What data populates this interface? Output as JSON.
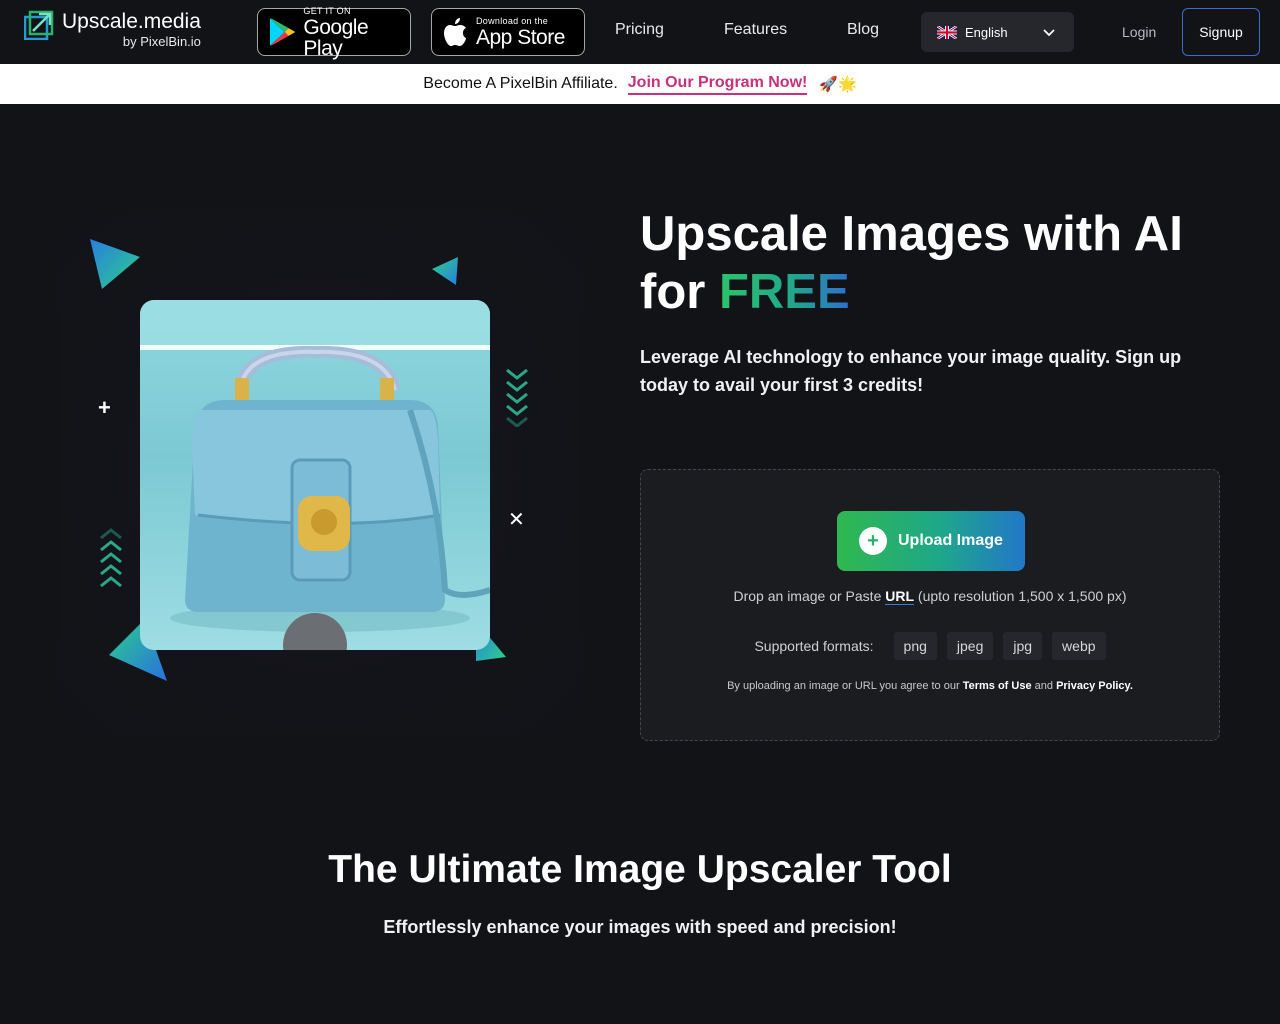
{
  "header": {
    "logo_title": "Upscale.media",
    "logo_sub": "by PixelBin.io",
    "google_play": {
      "small": "GET IT ON",
      "big": "Google Play"
    },
    "app_store": {
      "small": "Download on the",
      "big": "App Store"
    },
    "nav": {
      "pricing": "Pricing",
      "features": "Features",
      "blog": "Blog"
    },
    "language": "English",
    "login": "Login",
    "signup": "Signup"
  },
  "banner": {
    "text": "Become A PixelBin Affiliate.",
    "link": "Join Our Program Now!",
    "emoji": "🚀🌟"
  },
  "hero": {
    "title_line1": "Upscale Images with AI",
    "title_for": "for",
    "title_free": "FREE",
    "subtitle": "Leverage AI technology to enhance your image quality. Sign up today to avail your first 3 credits!"
  },
  "upload": {
    "button_label": "Upload Image",
    "drop_prefix": "Drop an image or Paste",
    "drop_url": "URL",
    "drop_suffix": "(upto resolution 1,500 x 1,500 px)",
    "formats_label": "Supported formats:",
    "formats": [
      "png",
      "jpeg",
      "jpg",
      "webp"
    ],
    "terms_prefix": "By uploading an image or URL you agree to our",
    "terms_link": "Terms of Use",
    "terms_and": "and",
    "privacy_link": "Privacy Policy."
  },
  "section": {
    "title": "The Ultimate Image Upscaler Tool",
    "subtitle": "Effortlessly enhance your images with speed and precision!"
  },
  "colors": {
    "background": "#121317",
    "accent_pink": "#c7317a",
    "accent_green": "#2fb84f",
    "accent_blue": "#2277c9"
  }
}
